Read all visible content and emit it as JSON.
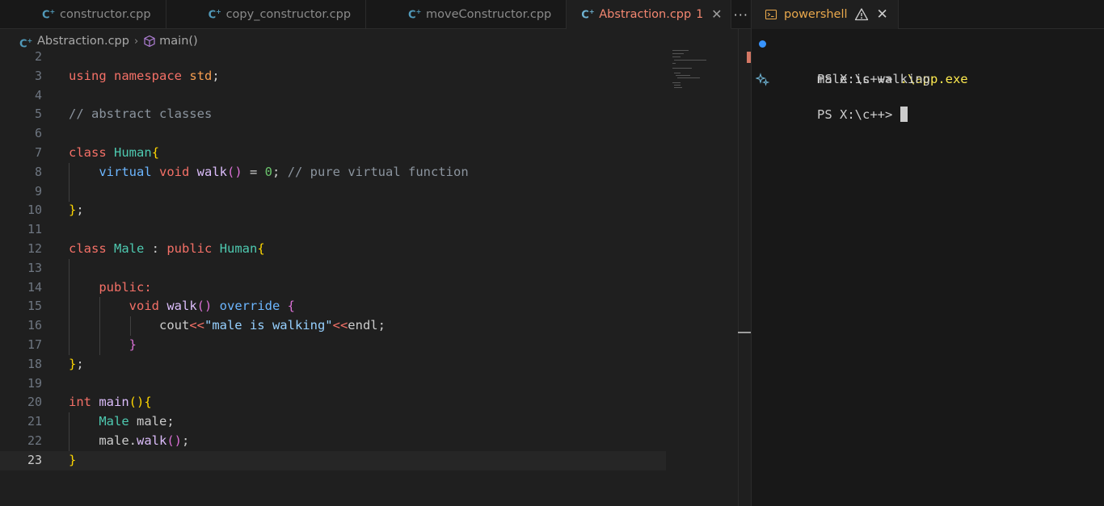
{
  "editor": {
    "tabs": [
      {
        "label": "constructor.cpp"
      },
      {
        "label": "copy_constructor.cpp"
      },
      {
        "label": "moveConstructor.cpp"
      }
    ],
    "active_tab": {
      "label": "Abstraction.cpp",
      "problems": "1",
      "close": "✕"
    },
    "more": "···",
    "breadcrumb": {
      "file": "Abstraction.cpp",
      "separator": "›",
      "symbol": "main()"
    },
    "lines": [
      {
        "num": "2",
        "tokens": []
      },
      {
        "num": "3",
        "tokens": [
          {
            "t": "using",
            "c": "kw"
          },
          {
            "t": " ",
            "c": "plain"
          },
          {
            "t": "namespace",
            "c": "kw"
          },
          {
            "t": " ",
            "c": "plain"
          },
          {
            "t": "std",
            "c": "ns"
          },
          {
            "t": ";",
            "c": "plain"
          }
        ]
      },
      {
        "num": "4",
        "tokens": []
      },
      {
        "num": "5",
        "tokens": [
          {
            "t": "// abstract classes",
            "c": "cmt"
          }
        ]
      },
      {
        "num": "6",
        "tokens": []
      },
      {
        "num": "7",
        "tokens": [
          {
            "t": "class",
            "c": "kw"
          },
          {
            "t": " ",
            "c": "plain"
          },
          {
            "t": "Human",
            "c": "typ"
          },
          {
            "t": "{",
            "c": "br1"
          }
        ]
      },
      {
        "num": "8",
        "tokens": [
          {
            "t": "    ",
            "c": "plain"
          },
          {
            "t": "virtual",
            "c": "kwb"
          },
          {
            "t": " ",
            "c": "plain"
          },
          {
            "t": "void",
            "c": "kw"
          },
          {
            "t": " ",
            "c": "plain"
          },
          {
            "t": "walk",
            "c": "fn"
          },
          {
            "t": "()",
            "c": "br2"
          },
          {
            "t": " = ",
            "c": "plain"
          },
          {
            "t": "0",
            "c": "num"
          },
          {
            "t": "; ",
            "c": "plain"
          },
          {
            "t": "// pure virtual function",
            "c": "cmt"
          }
        ]
      },
      {
        "num": "9",
        "tokens": []
      },
      {
        "num": "10",
        "tokens": [
          {
            "t": "}",
            "c": "br1"
          },
          {
            "t": ";",
            "c": "plain"
          }
        ]
      },
      {
        "num": "11",
        "tokens": []
      },
      {
        "num": "12",
        "tokens": [
          {
            "t": "class",
            "c": "kw"
          },
          {
            "t": " ",
            "c": "plain"
          },
          {
            "t": "Male",
            "c": "typ"
          },
          {
            "t": " : ",
            "c": "plain"
          },
          {
            "t": "public",
            "c": "kw"
          },
          {
            "t": " ",
            "c": "plain"
          },
          {
            "t": "Human",
            "c": "typ"
          },
          {
            "t": "{",
            "c": "br1"
          }
        ]
      },
      {
        "num": "13",
        "tokens": []
      },
      {
        "num": "14",
        "tokens": [
          {
            "t": "    ",
            "c": "plain"
          },
          {
            "t": "public:",
            "c": "kw"
          }
        ]
      },
      {
        "num": "15",
        "tokens": [
          {
            "t": "        ",
            "c": "plain"
          },
          {
            "t": "void",
            "c": "kw"
          },
          {
            "t": " ",
            "c": "plain"
          },
          {
            "t": "walk",
            "c": "fn"
          },
          {
            "t": "()",
            "c": "br2"
          },
          {
            "t": " ",
            "c": "plain"
          },
          {
            "t": "override",
            "c": "kwb"
          },
          {
            "t": " ",
            "c": "plain"
          },
          {
            "t": "{",
            "c": "br2"
          }
        ]
      },
      {
        "num": "16",
        "tokens": [
          {
            "t": "            ",
            "c": "plain"
          },
          {
            "t": "cout",
            "c": "plain"
          },
          {
            "t": "<<",
            "c": "op"
          },
          {
            "t": "\"male is walking\"",
            "c": "str"
          },
          {
            "t": "<<",
            "c": "op"
          },
          {
            "t": "endl",
            "c": "plain"
          },
          {
            "t": ";",
            "c": "plain"
          }
        ]
      },
      {
        "num": "17",
        "tokens": [
          {
            "t": "        ",
            "c": "plain"
          },
          {
            "t": "}",
            "c": "br2"
          }
        ]
      },
      {
        "num": "18",
        "tokens": [
          {
            "t": "}",
            "c": "br1"
          },
          {
            "t": ";",
            "c": "plain"
          }
        ]
      },
      {
        "num": "19",
        "tokens": []
      },
      {
        "num": "20",
        "tokens": [
          {
            "t": "int",
            "c": "kw"
          },
          {
            "t": " ",
            "c": "plain"
          },
          {
            "t": "main",
            "c": "fn"
          },
          {
            "t": "()",
            "c": "br1"
          },
          {
            "t": "{",
            "c": "br1"
          }
        ]
      },
      {
        "num": "21",
        "tokens": [
          {
            "t": "    ",
            "c": "plain"
          },
          {
            "t": "Male",
            "c": "typ"
          },
          {
            "t": " male;",
            "c": "plain"
          }
        ]
      },
      {
        "num": "22",
        "tokens": [
          {
            "t": "    ",
            "c": "plain"
          },
          {
            "t": "male.",
            "c": "plain"
          },
          {
            "t": "walk",
            "c": "fn"
          },
          {
            "t": "()",
            "c": "br2"
          },
          {
            "t": ";",
            "c": "plain"
          }
        ]
      },
      {
        "num": "23",
        "tokens": [
          {
            "t": "}",
            "c": "br1"
          }
        ],
        "current": true
      }
    ]
  },
  "terminal": {
    "tab_label": "powershell",
    "close": "✕",
    "lines": [
      {
        "prompt": "PS X:\\c++> ",
        "command": ".\\app.exe",
        "marker": "dot"
      },
      {
        "text": "male is walking"
      },
      {
        "prompt": "PS X:\\c++> ",
        "marker": "sparkle",
        "cursor": true
      }
    ]
  },
  "colors": {
    "accent_warning": "#f48771",
    "terminal_tab": "#e9a84c",
    "status_dot": "#3794ff"
  },
  "icons": {
    "file": "cpp-file-icon",
    "symbol": "method-cube-icon",
    "terminal": "terminal-icon",
    "warning": "warning-icon",
    "close": "close-icon"
  }
}
